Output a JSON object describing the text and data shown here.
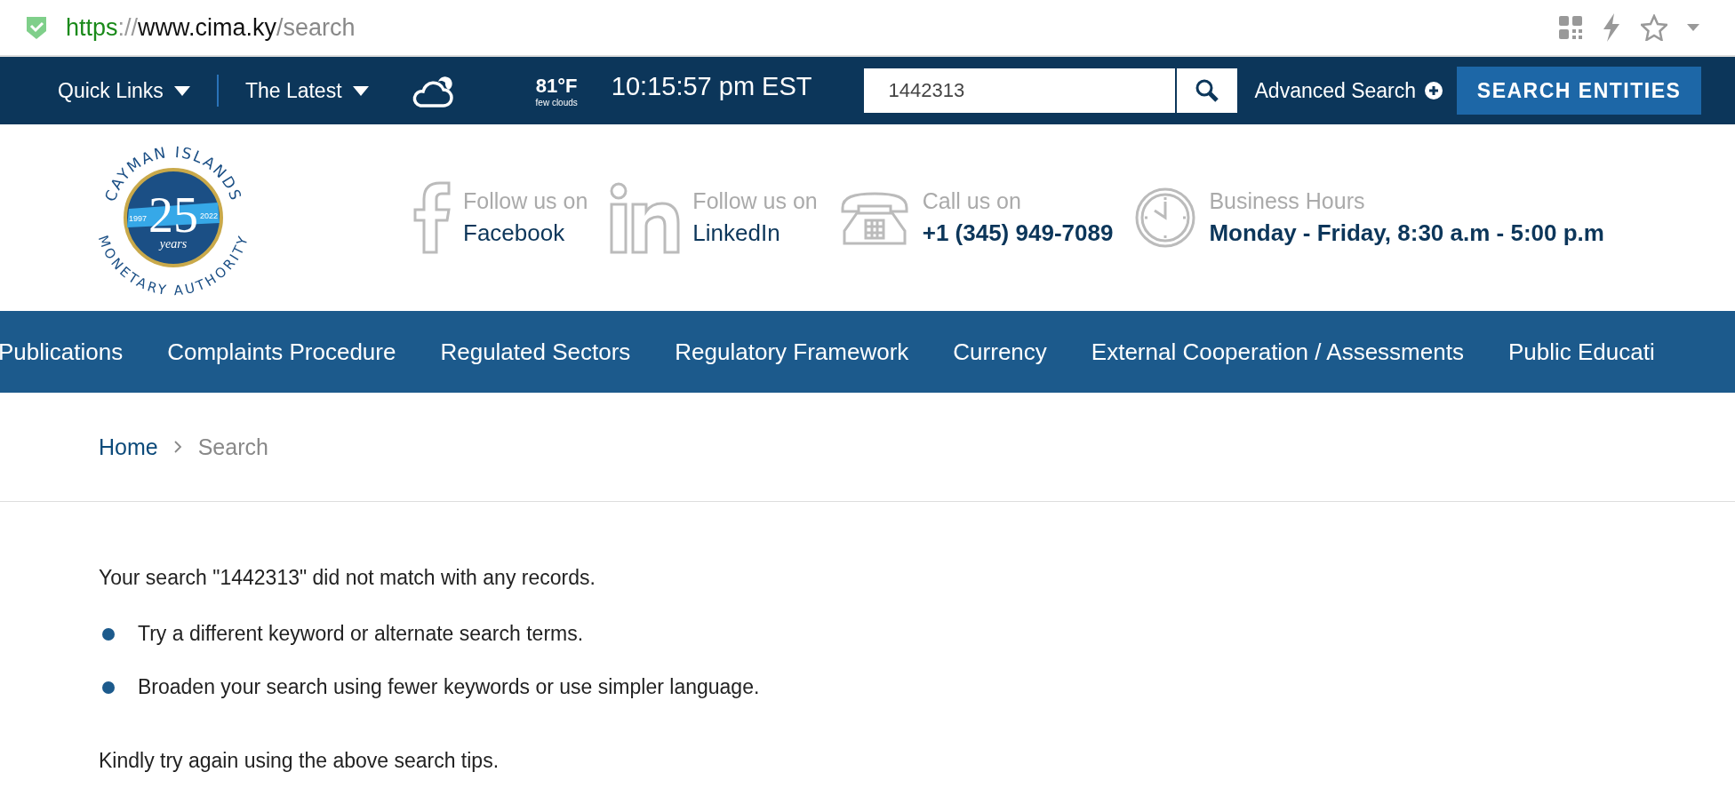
{
  "browser": {
    "url": {
      "scheme": "https",
      "separator": "://",
      "host": "www.cima.ky",
      "path": "/search"
    }
  },
  "topbar": {
    "menus": [
      {
        "label": "Quick Links"
      },
      {
        "label": "The Latest"
      }
    ],
    "weather": {
      "temperature": "81°F",
      "condition": "few clouds"
    },
    "time": "10:15:57 pm EST",
    "search": {
      "value": "1442313"
    },
    "advanced_search": "Advanced Search",
    "search_entities": "SEARCH ENTITIES"
  },
  "logo": {
    "top": "CAYMAN ISLANDS",
    "bottom": "MONETARY AUTHORITY",
    "number": "25",
    "years": "years",
    "start": "1997",
    "end": "2022"
  },
  "contacts": [
    {
      "kind": "facebook",
      "label": "Follow us on",
      "value": "Facebook"
    },
    {
      "kind": "linkedin",
      "label": "Follow us on",
      "value": "LinkedIn"
    },
    {
      "kind": "phone",
      "label": "Call us on",
      "value": "+1 (345) 949-7089"
    },
    {
      "kind": "hours",
      "label": "Business Hours",
      "value": "Monday - Friday, 8:30 a.m - 5:00 p.m"
    }
  ],
  "nav": [
    "Publications",
    "Complaints Procedure",
    "Regulated Sectors",
    "Regulatory Framework",
    "Currency",
    "External Cooperation / Assessments",
    "Public Educati"
  ],
  "breadcrumb": [
    "Home",
    "Search"
  ],
  "content": {
    "message": "Your search \"1442313\" did not match with any records.",
    "tips": [
      "Try a different keyword or alternate search terms.",
      "Broaden your search using fewer keywords or use simpler language."
    ],
    "closing": "Kindly try again using the above search tips."
  }
}
